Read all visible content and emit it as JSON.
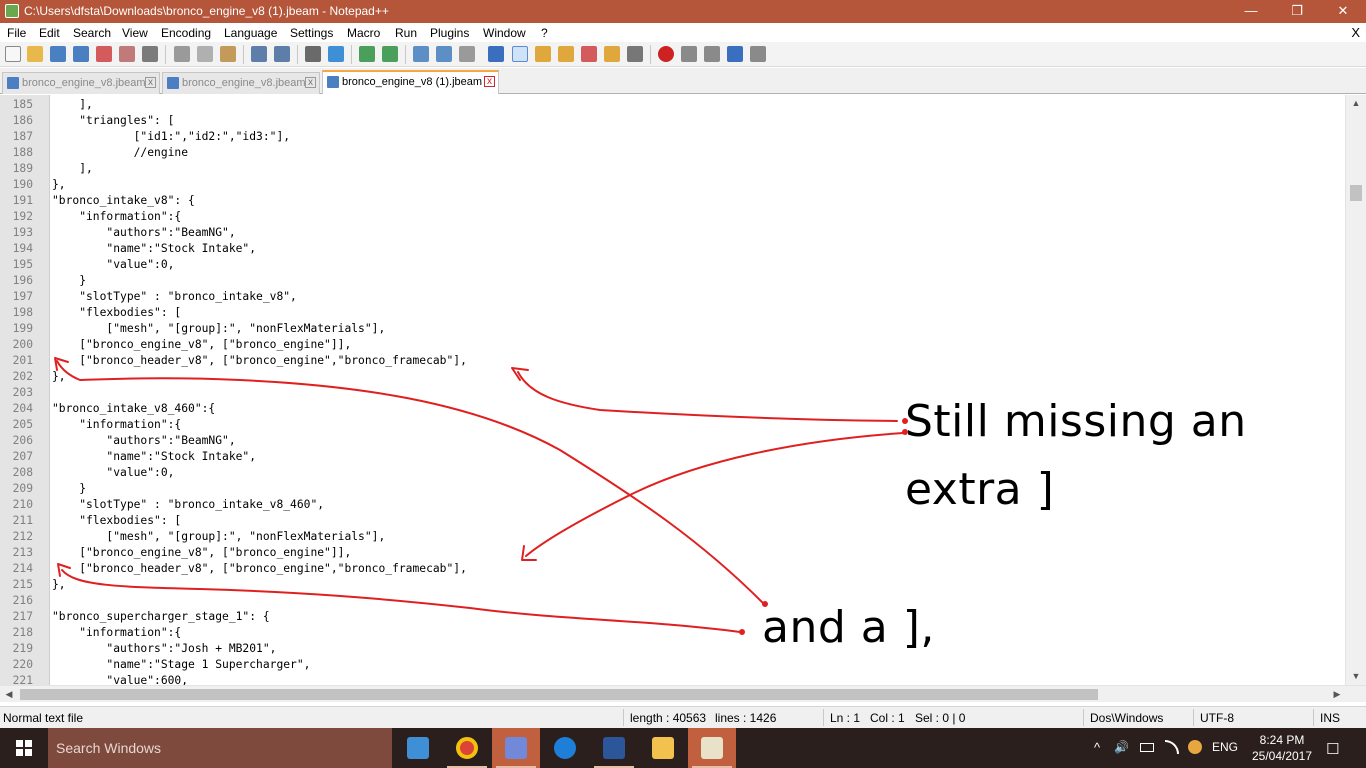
{
  "window": {
    "title": "C:\\Users\\dfsta\\Downloads\\bronco_engine_v8 (1).jbeam - Notepad++",
    "minimize_glyph": "—",
    "restore_glyph": "❐",
    "close_glyph": "✕"
  },
  "menu": {
    "items": [
      "File",
      "Edit",
      "Search",
      "View",
      "Encoding",
      "Language",
      "Settings",
      "Macro",
      "Run",
      "Plugins",
      "Window",
      "?"
    ],
    "close_glyph": "X"
  },
  "tabs": [
    {
      "label": "bronco_engine_v8.jbeam",
      "active": false
    },
    {
      "label": "bronco_engine_v8.jbeam",
      "active": false
    },
    {
      "label": "bronco_engine_v8 (1).jbeam",
      "active": true
    }
  ],
  "editor": {
    "lines": [
      {
        "n": "185",
        "text": "    ],"
      },
      {
        "n": "186",
        "text": "    \"triangles\": ["
      },
      {
        "n": "187",
        "text": "            [\"id1:\",\"id2:\",\"id3:\"],"
      },
      {
        "n": "188",
        "text": "            //engine"
      },
      {
        "n": "189",
        "text": "    ],"
      },
      {
        "n": "190",
        "text": "},"
      },
      {
        "n": "191",
        "text": "\"bronco_intake_v8\": {"
      },
      {
        "n": "192",
        "text": "    \"information\":{"
      },
      {
        "n": "193",
        "text": "        \"authors\":\"BeamNG\","
      },
      {
        "n": "194",
        "text": "        \"name\":\"Stock Intake\","
      },
      {
        "n": "195",
        "text": "        \"value\":0,"
      },
      {
        "n": "196",
        "text": "    }"
      },
      {
        "n": "197",
        "text": "    \"slotType\" : \"bronco_intake_v8\","
      },
      {
        "n": "198",
        "text": "    \"flexbodies\": ["
      },
      {
        "n": "199",
        "text": "        [\"mesh\", \"[group]:\", \"nonFlexMaterials\"],"
      },
      {
        "n": "200",
        "text": "    [\"bronco_engine_v8\", [\"bronco_engine\"]],"
      },
      {
        "n": "201",
        "text": "    [\"bronco_header_v8\", [\"bronco_engine\",\"bronco_framecab\"],"
      },
      {
        "n": "202",
        "text": "},"
      },
      {
        "n": "203",
        "text": ""
      },
      {
        "n": "204",
        "text": "\"bronco_intake_v8_460\":{"
      },
      {
        "n": "205",
        "text": "    \"information\":{"
      },
      {
        "n": "206",
        "text": "        \"authors\":\"BeamNG\","
      },
      {
        "n": "207",
        "text": "        \"name\":\"Stock Intake\","
      },
      {
        "n": "208",
        "text": "        \"value\":0,"
      },
      {
        "n": "209",
        "text": "    }"
      },
      {
        "n": "210",
        "text": "    \"slotType\" : \"bronco_intake_v8_460\","
      },
      {
        "n": "211",
        "text": "    \"flexbodies\": ["
      },
      {
        "n": "212",
        "text": "        [\"mesh\", \"[group]:\", \"nonFlexMaterials\"],"
      },
      {
        "n": "213",
        "text": "    [\"bronco_engine_v8\", [\"bronco_engine\"]],"
      },
      {
        "n": "214",
        "text": "    [\"bronco_header_v8\", [\"bronco_engine\",\"bronco_framecab\"],"
      },
      {
        "n": "215",
        "text": "},"
      },
      {
        "n": "216",
        "text": ""
      },
      {
        "n": "217",
        "text": "\"bronco_supercharger_stage_1\": {"
      },
      {
        "n": "218",
        "text": "    \"information\":{"
      },
      {
        "n": "219",
        "text": "        \"authors\":\"Josh + MB201\","
      },
      {
        "n": "220",
        "text": "        \"name\":\"Stage 1 Supercharger\","
      },
      {
        "n": "221",
        "text": "        \"value\":600,"
      }
    ]
  },
  "annotations": {
    "line1": "Still missing an",
    "line2": "extra ]",
    "line3": "and a ],",
    "color": "#e02020"
  },
  "statusbar": {
    "file_type": "Normal text file",
    "length": "length : 40563",
    "lines": "lines : 1426",
    "ln": "Ln : 1",
    "col": "Col : 1",
    "sel": "Sel : 0 | 0",
    "eol": "Dos\\Windows",
    "encoding": "UTF-8",
    "mode": "INS"
  },
  "taskbar": {
    "search_placeholder": "Search Windows",
    "language": "ENG",
    "time": "8:24 PM",
    "date": "25/04/2017",
    "chevron_glyph": "^",
    "volume_glyph": "🔊",
    "notification_glyph": "☐"
  }
}
